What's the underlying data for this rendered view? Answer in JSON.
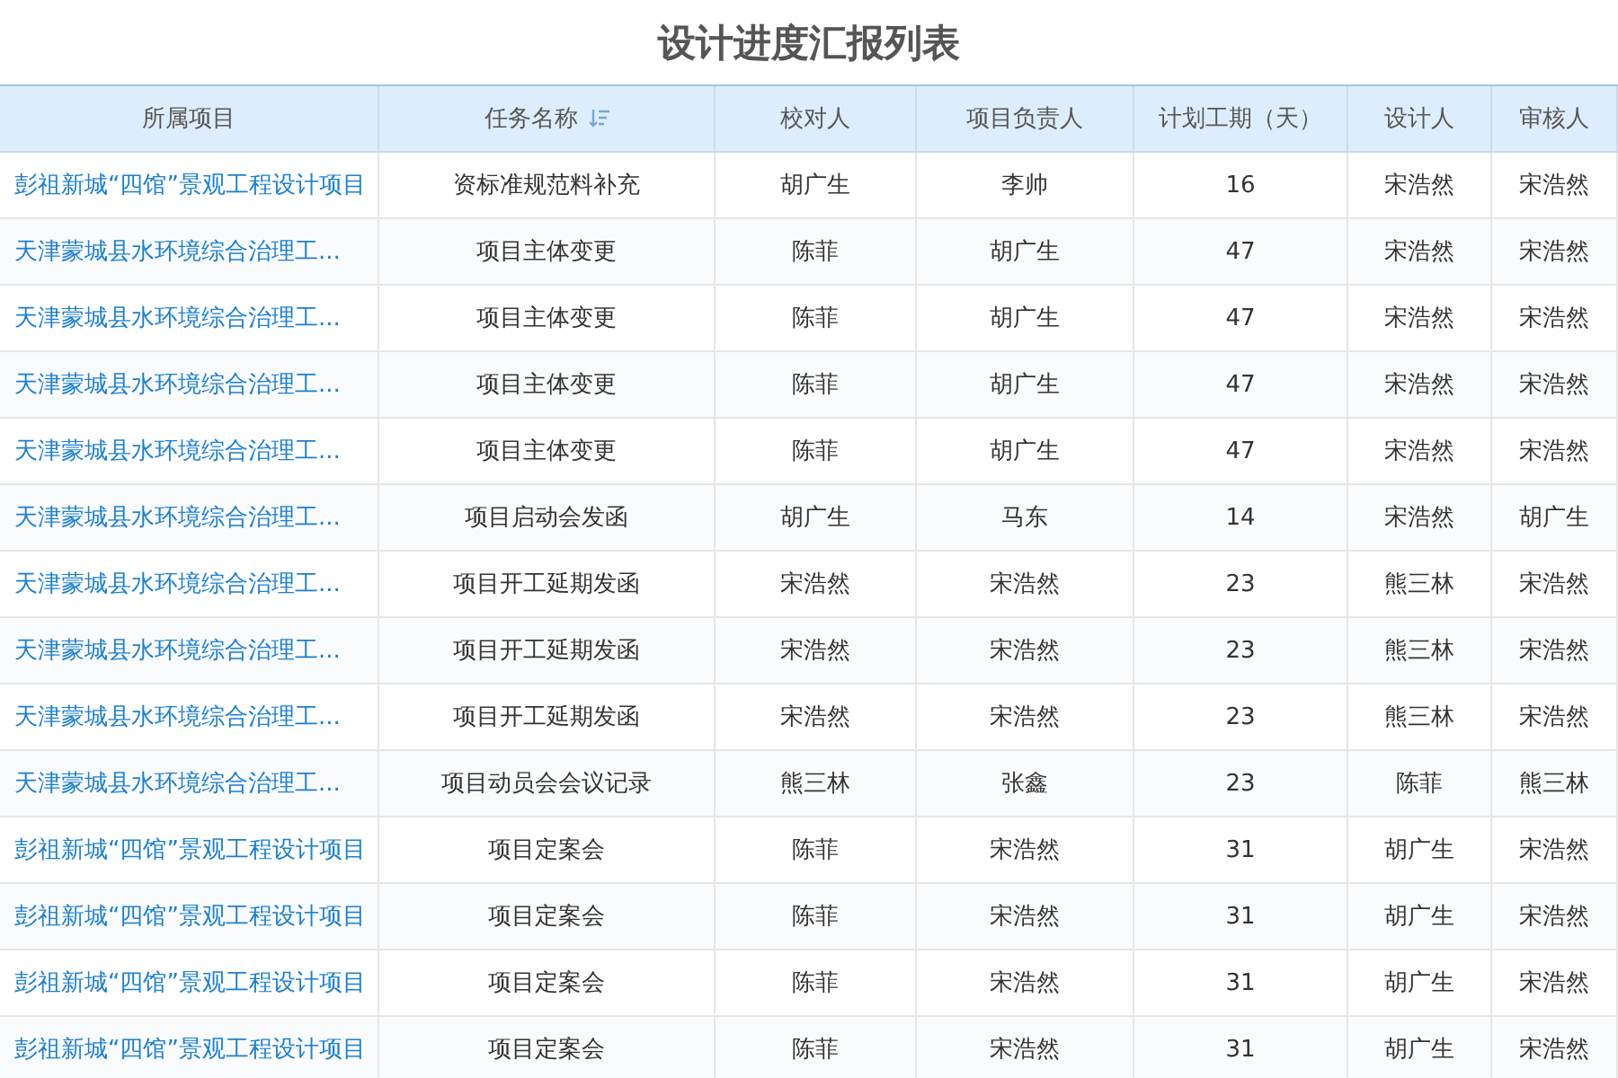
{
  "title": "设计进度汇报列表",
  "table": {
    "columns": [
      {
        "label": "所属项目",
        "sortable": false
      },
      {
        "label": "任务名称",
        "sortable": true
      },
      {
        "label": "校对人",
        "sortable": false
      },
      {
        "label": "项目负责人",
        "sortable": false
      },
      {
        "label": "计划工期（天）",
        "sortable": false
      },
      {
        "label": "设计人",
        "sortable": false
      },
      {
        "label": "审核人",
        "sortable": false
      }
    ],
    "rows": [
      [
        "彭祖新城“四馆”景观工程设计项目",
        "资标准规范料补充",
        "胡广生",
        "李帅",
        "16",
        "宋浩然",
        "宋浩然"
      ],
      [
        "天津蒙城县水环境综合治理工...",
        "项目主体变更",
        "陈菲",
        "胡广生",
        "47",
        "宋浩然",
        "宋浩然"
      ],
      [
        "天津蒙城县水环境综合治理工...",
        "项目主体变更",
        "陈菲",
        "胡广生",
        "47",
        "宋浩然",
        "宋浩然"
      ],
      [
        "天津蒙城县水环境综合治理工...",
        "项目主体变更",
        "陈菲",
        "胡广生",
        "47",
        "宋浩然",
        "宋浩然"
      ],
      [
        "天津蒙城县水环境综合治理工...",
        "项目主体变更",
        "陈菲",
        "胡广生",
        "47",
        "宋浩然",
        "宋浩然"
      ],
      [
        "天津蒙城县水环境综合治理工...",
        "项目启动会发函",
        "胡广生",
        "马东",
        "14",
        "宋浩然",
        "胡广生"
      ],
      [
        "天津蒙城县水环境综合治理工...",
        "项目开工延期发函",
        "宋浩然",
        "宋浩然",
        "23",
        "熊三林",
        "宋浩然"
      ],
      [
        "天津蒙城县水环境综合治理工...",
        "项目开工延期发函",
        "宋浩然",
        "宋浩然",
        "23",
        "熊三林",
        "宋浩然"
      ],
      [
        "天津蒙城县水环境综合治理工...",
        "项目开工延期发函",
        "宋浩然",
        "宋浩然",
        "23",
        "熊三林",
        "宋浩然"
      ],
      [
        "天津蒙城县水环境综合治理工...",
        "项目动员会会议记录",
        "熊三林",
        "张鑫",
        "23",
        "陈菲",
        "熊三林"
      ],
      [
        "彭祖新城“四馆”景观工程设计项目",
        "项目定案会",
        "陈菲",
        "宋浩然",
        "31",
        "胡广生",
        "宋浩然"
      ],
      [
        "彭祖新城“四馆”景观工程设计项目",
        "项目定案会",
        "陈菲",
        "宋浩然",
        "31",
        "胡广生",
        "宋浩然"
      ],
      [
        "彭祖新城“四馆”景观工程设计项目",
        "项目定案会",
        "陈菲",
        "宋浩然",
        "31",
        "胡广生",
        "宋浩然"
      ],
      [
        "彭祖新城“四馆”景观工程设计项目",
        "项目定案会",
        "陈菲",
        "宋浩然",
        "31",
        "胡广生",
        "宋浩然"
      ]
    ]
  }
}
